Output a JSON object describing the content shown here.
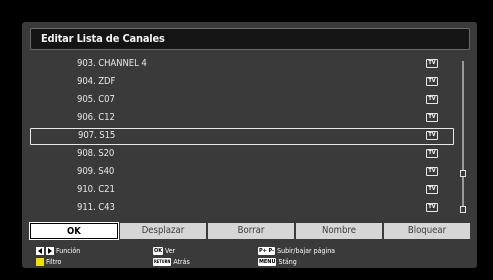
{
  "title": "Editar Lista de Canales",
  "channels": [
    {
      "label": "903. CHANNEL 4",
      "type": "TV"
    },
    {
      "label": "904. ZDF",
      "type": "TV"
    },
    {
      "label": "905. C07",
      "type": "TV"
    },
    {
      "label": "906. C12",
      "type": "TV"
    },
    {
      "label": "907. S15",
      "type": "TV"
    },
    {
      "label": "908. S20",
      "type": "TV"
    },
    {
      "label": "909. S40",
      "type": "TV"
    },
    {
      "label": "910. C21",
      "type": "TV"
    },
    {
      "label": "911. C43",
      "type": "TV"
    }
  ],
  "selected_channel": "907. S15",
  "buttons": [
    "OK",
    "Desplazar",
    "Borrar",
    "Nombre",
    "Bloquear"
  ],
  "active_button": "OK",
  "legend": {
    "funcion": "Función",
    "filtro": "Filtro",
    "ok_key": "OK",
    "ver": "Ver",
    "return_key": "RETURN",
    "atras": "Atrás",
    "page_keys": "P+ P-",
    "subir_bajar": "Subir/bajar página",
    "menu_key": "MENU",
    "salir": "Stäng"
  },
  "colors": {
    "filter_swatch": "#f0e000",
    "panel": "#3a3a3a"
  }
}
